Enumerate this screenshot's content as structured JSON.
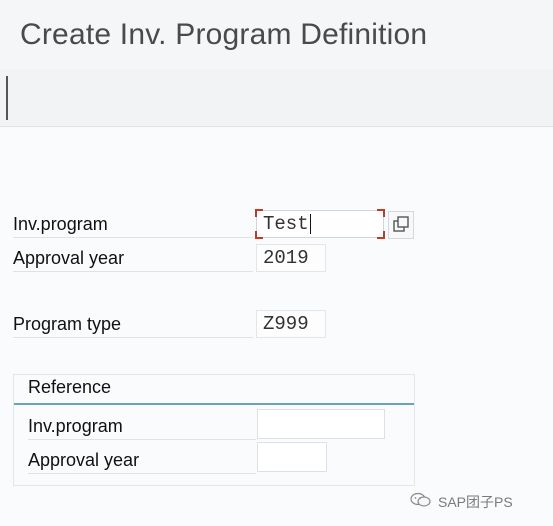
{
  "window": {
    "title": "Create Inv. Program Definition"
  },
  "form": {
    "inv_program": {
      "label": "Inv.program",
      "value": "Test"
    },
    "approval_year": {
      "label": "Approval year",
      "value": "2019"
    },
    "program_type": {
      "label": "Program type",
      "value": "Z999"
    }
  },
  "reference": {
    "title": "Reference",
    "inv_program": {
      "label": "Inv.program",
      "value": ""
    },
    "approval_year": {
      "label": "Approval year",
      "value": ""
    }
  },
  "watermark": {
    "text": "SAP团子PS",
    "icon": "wechat-icon"
  },
  "colors": {
    "focus_corner": "#c0392b",
    "group_underline": "#6aa3b8"
  }
}
